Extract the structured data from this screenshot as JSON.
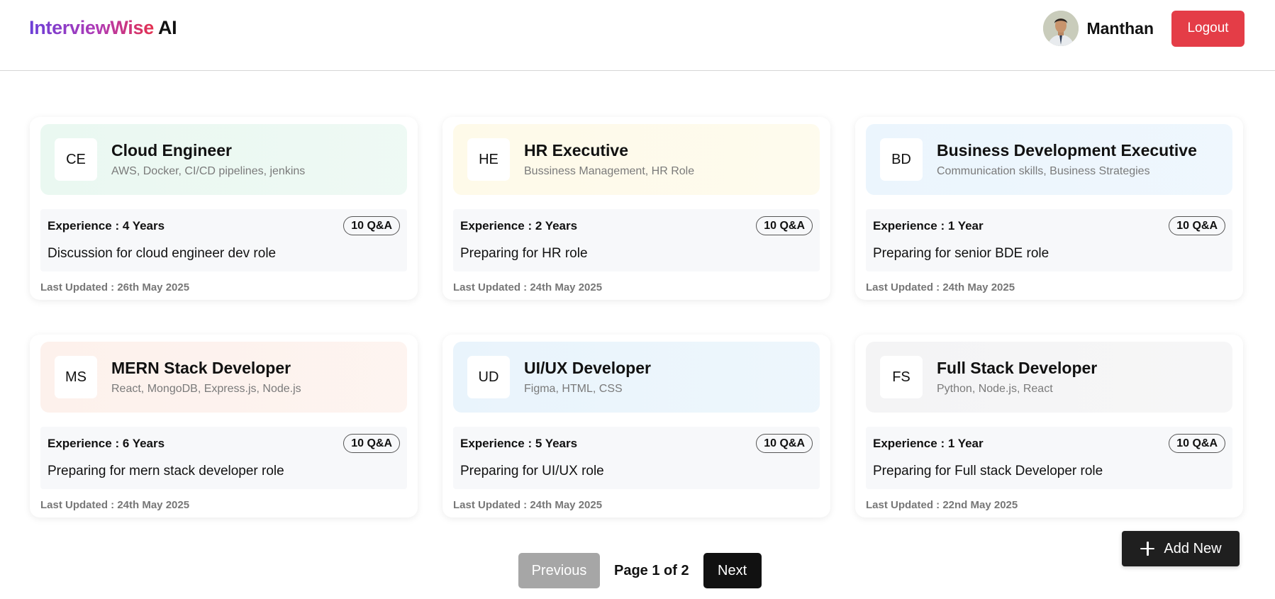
{
  "header": {
    "brand_main": "InterviewWise",
    "brand_suffix": "AI",
    "user_name": "Manthan",
    "logout_label": "Logout"
  },
  "sessions": [
    {
      "initials": "CE",
      "title": "Cloud Engineer",
      "skills": "AWS, Docker, CI/CD pipelines, jenkins",
      "experience": "Experience : 4 Years",
      "qa_count": "10 Q&A",
      "description": "Discussion for cloud engineer dev role",
      "last_updated": "Last Updated : 26th May 2025",
      "head_color": "#eaf8f1"
    },
    {
      "initials": "HE",
      "title": "HR Executive",
      "skills": "Bussiness Management, HR Role",
      "experience": "Experience : 2 Years",
      "qa_count": "10 Q&A",
      "description": "Preparing for HR role",
      "last_updated": "Last Updated : 24th May 2025",
      "head_color": "#fefae9"
    },
    {
      "initials": "BD",
      "title": "Business Development Executive",
      "skills": "Communication skills, Business Strategies",
      "experience": "Experience : 1 Year",
      "qa_count": "10 Q&A",
      "description": "Preparing for senior BDE role",
      "last_updated": "Last Updated : 24th May 2025",
      "head_color": "#ebf5fd"
    },
    {
      "initials": "MS",
      "title": "MERN Stack Developer",
      "skills": "React, MongoDB, Express.js, Node.js",
      "experience": "Experience : 6 Years",
      "qa_count": "10 Q&A",
      "description": "Preparing for mern stack developer role",
      "last_updated": "Last Updated : 24th May 2025",
      "head_color": "#fdf1ec"
    },
    {
      "initials": "UD",
      "title": "UI/UX Developer",
      "skills": "Figma, HTML, CSS",
      "experience": "Experience : 5 Years",
      "qa_count": "10 Q&A",
      "description": "Preparing for UI/UX role",
      "last_updated": "Last Updated : 24th May 2025",
      "head_color": "#e9f4fc"
    },
    {
      "initials": "FS",
      "title": "Full Stack Developer",
      "skills": "Python, Node.js, React",
      "experience": "Experience : 1 Year",
      "qa_count": "10 Q&A",
      "description": "Preparing for Full stack Developer role",
      "last_updated": "Last Updated : 22nd May 2025",
      "head_color": "#f4f4f5"
    }
  ],
  "actions": {
    "add_new_label": "Add New"
  },
  "pagination": {
    "previous_label": "Previous",
    "page_indicator": "Page 1 of 2",
    "next_label": "Next"
  }
}
